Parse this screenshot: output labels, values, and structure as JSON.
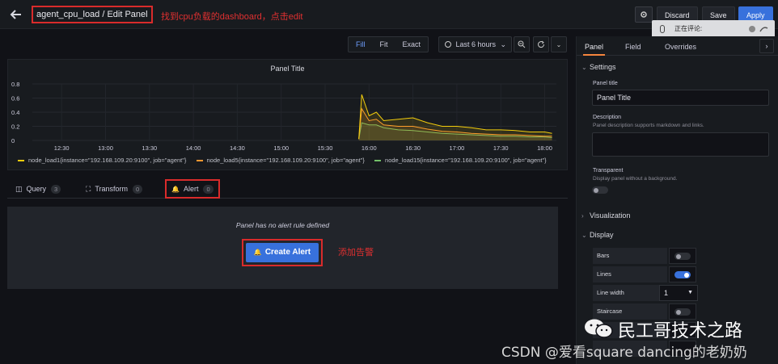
{
  "header": {
    "breadcrumb": "agent_cpu_load / Edit Panel",
    "annotation_title": "找到cpu负载的dashboard，点击edit",
    "discard_label": "Discard",
    "save_label": "Save",
    "apply_label": "Apply",
    "voice_popup_text": "正在评论:"
  },
  "toolbar": {
    "view_modes": [
      "Fill",
      "Fit",
      "Exact"
    ],
    "active_view_mode": "Fill",
    "time_range": "Last 6 hours"
  },
  "panel": {
    "title": "Panel Title",
    "legend": [
      {
        "label": "node_load1{instance=\"192.168.109.20:9100\", job=\"agent\"}",
        "color": "#f2cc0c"
      },
      {
        "label": "node_load5{instance=\"192.168.109.20:9100\", job=\"agent\"}",
        "color": "#ff9830"
      },
      {
        "label": "node_load15{instance=\"192.168.109.20:9100\", job=\"agent\"}",
        "color": "#73bf69"
      }
    ]
  },
  "chart_data": {
    "type": "line",
    "title": "Panel Title",
    "x_ticks": [
      "12:30",
      "13:00",
      "13:30",
      "14:00",
      "14:30",
      "15:00",
      "15:30",
      "16:00",
      "16:30",
      "17:00",
      "17:30",
      "18:00"
    ],
    "y_ticks": [
      "0",
      "0.2",
      "0.4",
      "0.6",
      "0.8"
    ],
    "ylim": [
      0,
      0.8
    ],
    "x": [
      "15:53",
      "15:55",
      "16:00",
      "16:05",
      "16:10",
      "16:20",
      "16:30",
      "16:40",
      "16:50",
      "17:00",
      "17:10",
      "17:20",
      "17:30",
      "17:40",
      "17:50",
      "18:00",
      "18:05"
    ],
    "series": [
      {
        "name": "node_load1{instance=\"192.168.109.20:9100\", job=\"agent\"}",
        "values": [
          0.02,
          0.65,
          0.35,
          0.4,
          0.28,
          0.3,
          0.32,
          0.25,
          0.2,
          0.2,
          0.18,
          0.15,
          0.15,
          0.14,
          0.12,
          0.12,
          0.1
        ]
      },
      {
        "name": "node_load5{instance=\"192.168.109.20:9100\", job=\"agent\"}",
        "values": [
          0.02,
          0.45,
          0.28,
          0.3,
          0.22,
          0.2,
          0.2,
          0.16,
          0.13,
          0.12,
          0.1,
          0.09,
          0.08,
          0.08,
          0.07,
          0.06,
          0.06
        ]
      },
      {
        "name": "node_load15{instance=\"192.168.109.20:9100\", job=\"agent\"}",
        "values": [
          0.02,
          0.25,
          0.22,
          0.22,
          0.18,
          0.15,
          0.14,
          0.12,
          0.1,
          0.09,
          0.08,
          0.07,
          0.06,
          0.06,
          0.05,
          0.05,
          0.04
        ]
      }
    ],
    "grid": true,
    "legend_position": "bottom"
  },
  "query_tabs": {
    "query_label": "Query",
    "query_count": "3",
    "transform_label": "Transform",
    "transform_count": "0",
    "alert_label": "Alert",
    "alert_count": "0"
  },
  "alert": {
    "no_rule_text": "Panel has no alert rule defined",
    "create_label": "Create Alert",
    "annotation": "添加告警"
  },
  "options": {
    "tabs": [
      "Panel",
      "Field",
      "Overrides"
    ],
    "active_tab": "Panel",
    "settings_label": "Settings",
    "panel_title_label": "Panel title",
    "panel_title_value": "Panel Title",
    "description_label": "Description",
    "description_hint": "Panel description supports markdown and links.",
    "transparent_label": "Transparent",
    "transparent_hint": "Display panel without a background.",
    "transparent": false,
    "visualization_label": "Visualization",
    "display_label": "Display",
    "bars_label": "Bars",
    "bars": false,
    "lines_label": "Lines",
    "lines": true,
    "line_width_label": "Line width",
    "line_width_value": "1",
    "staircase_label": "Staircase",
    "staircase": false
  },
  "watermark": {
    "line1": "民工哥技术之路",
    "line2": "CSDN @爱看square dancing的老奶奶"
  }
}
